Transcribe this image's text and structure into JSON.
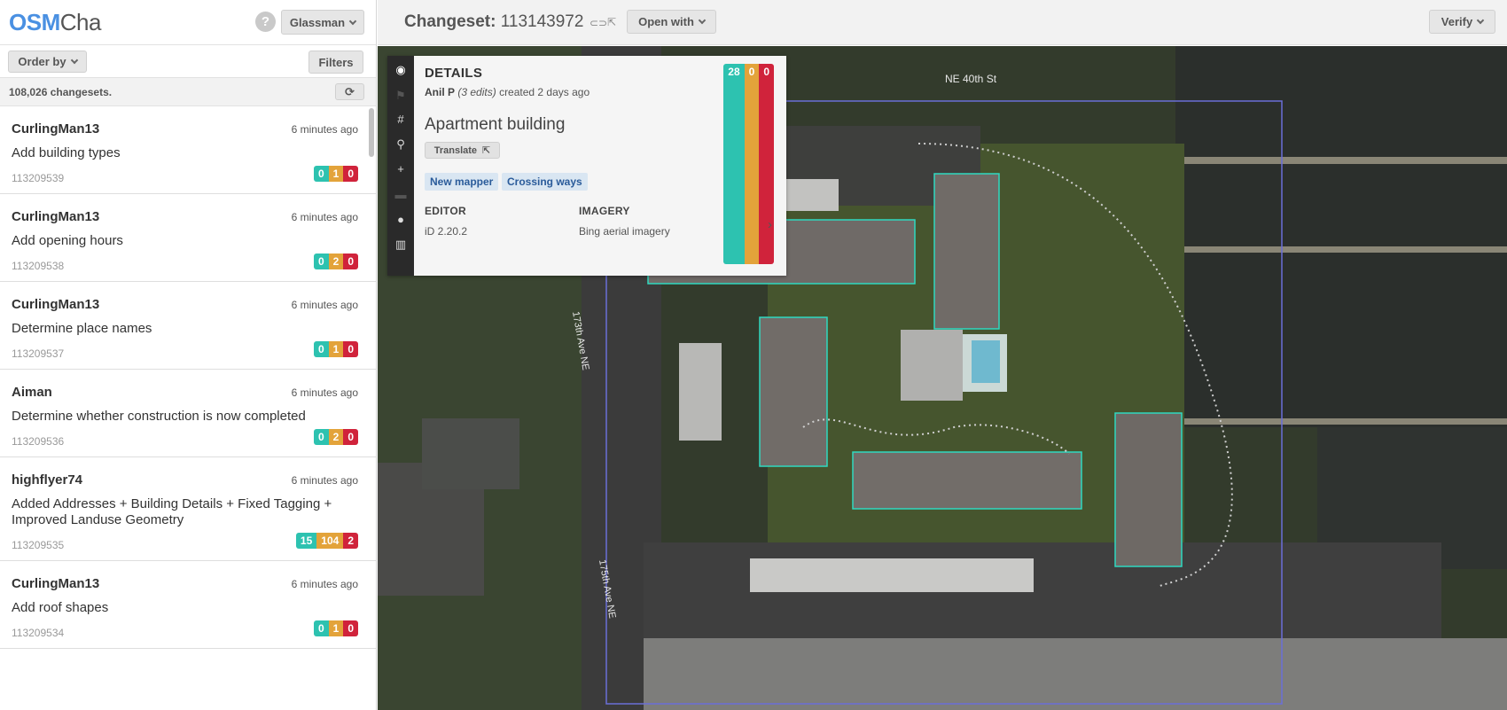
{
  "app": {
    "logo_osm": "OSM",
    "logo_cha": "Cha",
    "help": "?",
    "user": "Glassman"
  },
  "sidebar": {
    "order_by": "Order by",
    "filters": "Filters",
    "count_text": "108,026 changesets.",
    "refresh": "⟳",
    "changesets": [
      {
        "user": "CurlingMan13",
        "time": "6 minutes ago",
        "comment": "Add building types",
        "id": "113209539",
        "badges": [
          "0",
          "1",
          "0"
        ]
      },
      {
        "user": "CurlingMan13",
        "time": "6 minutes ago",
        "comment": "Add opening hours",
        "id": "113209538",
        "badges": [
          "0",
          "2",
          "0"
        ]
      },
      {
        "user": "CurlingMan13",
        "time": "6 minutes ago",
        "comment": "Determine place names",
        "id": "113209537",
        "badges": [
          "0",
          "1",
          "0"
        ]
      },
      {
        "user": "Aiman",
        "time": "6 minutes ago",
        "comment": "Determine whether construction is now completed",
        "id": "113209536",
        "badges": [
          "0",
          "2",
          "0"
        ]
      },
      {
        "user": "highflyer74",
        "time": "6 minutes ago",
        "comment": "Added Addresses + Building Details + Fixed Tagging + Improved Landuse Geometry",
        "id": "113209535",
        "badges": [
          "15",
          "104",
          "2"
        ]
      },
      {
        "user": "CurlingMan13",
        "time": "6 minutes ago",
        "comment": "Add roof shapes",
        "id": "113209534",
        "badges": [
          "0",
          "1",
          "0"
        ]
      }
    ]
  },
  "header": {
    "title_label": "Changeset:",
    "title_number": "113143972",
    "open_with": "Open with",
    "verify": "Verify"
  },
  "map": {
    "street_label_1": "NE 40th St",
    "street_label_2": "173th Ave NE",
    "street_label_3": "175th Ave NE"
  },
  "panel": {
    "title": "DETAILS",
    "badges": [
      "28",
      "0",
      "0"
    ],
    "author": "Anil P",
    "edits": "(3 edits)",
    "created": "created 2 days ago",
    "comment": "Apartment building",
    "translate": "Translate",
    "tags": [
      "New mapper",
      "Crossing ways"
    ],
    "editor_label": "EDITOR",
    "editor_value": "iD 2.20.2",
    "imagery_label": "IMAGERY",
    "imagery_value": "Bing aerial imagery"
  },
  "colors": {
    "accent": "#4a90e2",
    "created": "#2dc2b0",
    "modified": "#e3a33a",
    "deleted": "#d0233b",
    "bbox": "#6b6fd8",
    "building_outline": "#2fd9c0"
  },
  "icons": [
    "help-icon",
    "chevron-down-icon",
    "refresh-icon",
    "link-icon",
    "external-link-icon",
    "eye-icon",
    "flag-icon",
    "hash-icon",
    "share-icon",
    "plus-icon",
    "comment-icon",
    "user-icon",
    "map-icon",
    "chevron-right-icon"
  ]
}
